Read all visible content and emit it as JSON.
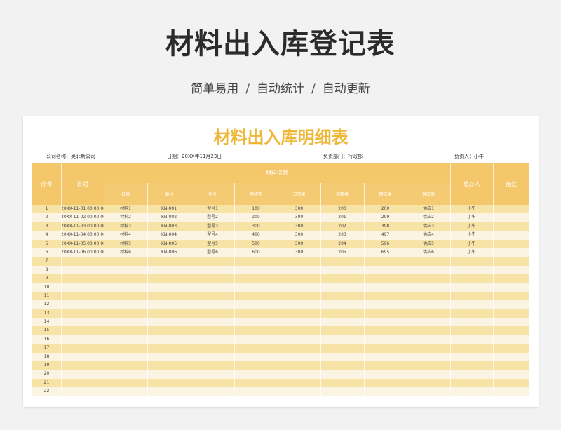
{
  "hero": {
    "title": "材料出入库登记表",
    "tagline_parts": [
      "简单易用",
      "自动统计",
      "自动更新"
    ],
    "separator": "/"
  },
  "sheet": {
    "title": "材料出入库明细表",
    "company": "公司名称：奥菲斯公司",
    "date": "日期：20XX年11月23日",
    "department": "负责部门：行政部",
    "person": "负责人：小牛",
    "headers": {
      "seq": "序号",
      "date": "日期",
      "material_info": "材料信息",
      "handler": "经办人",
      "remark": "备注",
      "sub": [
        "名称",
        "编号",
        "型号",
        "期初存",
        "进货量",
        "销售量",
        "期末量",
        "供应商"
      ]
    },
    "rows": [
      {
        "seq": "1",
        "date": "20XX-11-01 00:00:00",
        "name": "材料1",
        "code": "KN-001",
        "model": "型号1",
        "opening": "100",
        "in": "300",
        "out": "200",
        "closing": "200",
        "supplier": "供应1",
        "handler": "小牛",
        "remark": ""
      },
      {
        "seq": "2",
        "date": "20XX-11-02 00:00:00",
        "name": "材料2",
        "code": "KN-002",
        "model": "型号2",
        "opening": "200",
        "in": "300",
        "out": "201",
        "closing": "299",
        "supplier": "供应2",
        "handler": "小牛",
        "remark": ""
      },
      {
        "seq": "3",
        "date": "20XX-11-03 00:00:00",
        "name": "材料3",
        "code": "KN-003",
        "model": "型号3",
        "opening": "300",
        "in": "300",
        "out": "202",
        "closing": "398",
        "supplier": "供应3",
        "handler": "小牛",
        "remark": ""
      },
      {
        "seq": "4",
        "date": "20XX-11-04 00:00:00",
        "name": "材料4",
        "code": "KN-004",
        "model": "型号4",
        "opening": "400",
        "in": "300",
        "out": "203",
        "closing": "497",
        "supplier": "供应4",
        "handler": "小牛",
        "remark": ""
      },
      {
        "seq": "5",
        "date": "20XX-11-05 00:00:00",
        "name": "材料5",
        "code": "KN-005",
        "model": "型号5",
        "opening": "500",
        "in": "300",
        "out": "204",
        "closing": "596",
        "supplier": "供应5",
        "handler": "小牛",
        "remark": ""
      },
      {
        "seq": "6",
        "date": "20XX-11-06 00:00:00",
        "name": "材料6",
        "code": "KN-006",
        "model": "型号6",
        "opening": "600",
        "in": "300",
        "out": "205",
        "closing": "695",
        "supplier": "供应6",
        "handler": "小牛",
        "remark": ""
      },
      {
        "seq": "7"
      },
      {
        "seq": "8"
      },
      {
        "seq": "9"
      },
      {
        "seq": "10"
      },
      {
        "seq": "11"
      },
      {
        "seq": "12"
      },
      {
        "seq": "13"
      },
      {
        "seq": "14"
      },
      {
        "seq": "15"
      },
      {
        "seq": "16"
      },
      {
        "seq": "17"
      },
      {
        "seq": "18"
      },
      {
        "seq": "19"
      },
      {
        "seq": "20"
      },
      {
        "seq": "21"
      },
      {
        "seq": "22"
      }
    ]
  }
}
